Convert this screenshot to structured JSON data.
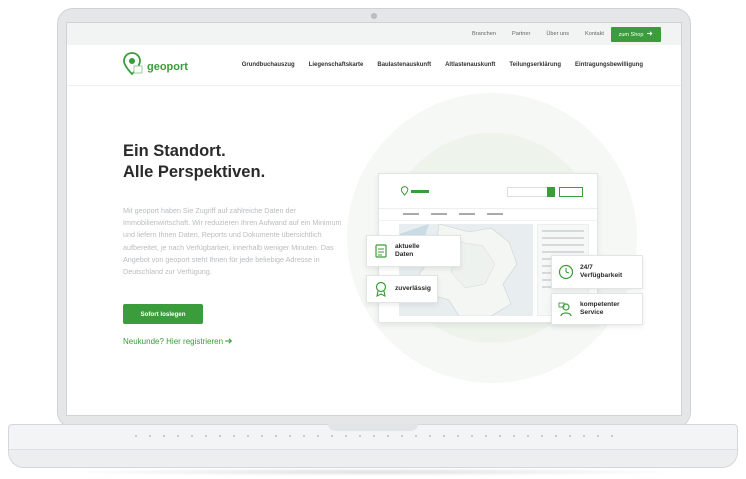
{
  "topnav": {
    "items": [
      "Branchen",
      "Partner",
      "Über uns",
      "Kontakt"
    ],
    "shop_label": "zum Shop"
  },
  "logo": {
    "text": "geoport"
  },
  "mainnav": {
    "items": [
      "Grundbuchauszug",
      "Liegenschaftskarte",
      "Baulastenauskunft",
      "Altlastenauskunft",
      "Teilungserklärung",
      "Eintragungsbewilligung"
    ]
  },
  "hero": {
    "headline_line1": "Ein Standort.",
    "headline_line2": "Alle Perspektiven.",
    "description": "Mit geoport haben Sie Zugriff auf zahlreiche Daten der Immobilienwirtschaft. Wir reduzieren Ihren Aufwand auf ein Minimum und liefern Ihnen Daten, Reports und Dokumente übersichtlich aufbereitet, je nach Verfügbarkeit, innerhalb weniger Minuten. Das Angebot von geoport steht Ihnen für jede beliebige Adresse in Deutschland zur Verfügung.",
    "cta_label": "Sofort loslegen",
    "register_label": "Neukunde? Hier registrieren"
  },
  "features": {
    "current_data_1": "aktuelle",
    "current_data_2": "Daten",
    "reliable": "zuverlässig",
    "availability_1": "24/7",
    "availability_2": "Verfügbarkeit",
    "service_1": "kompetenter",
    "service_2": "Service"
  },
  "colors": {
    "accent": "#3a9c3a",
    "text": "#2a2a2a",
    "muted": "#b9bcbf"
  },
  "icons": [
    "search-icon",
    "arrow-right-icon",
    "logo-pin-icon",
    "document-icon",
    "award-icon",
    "clock-24-icon",
    "support-icon"
  ]
}
